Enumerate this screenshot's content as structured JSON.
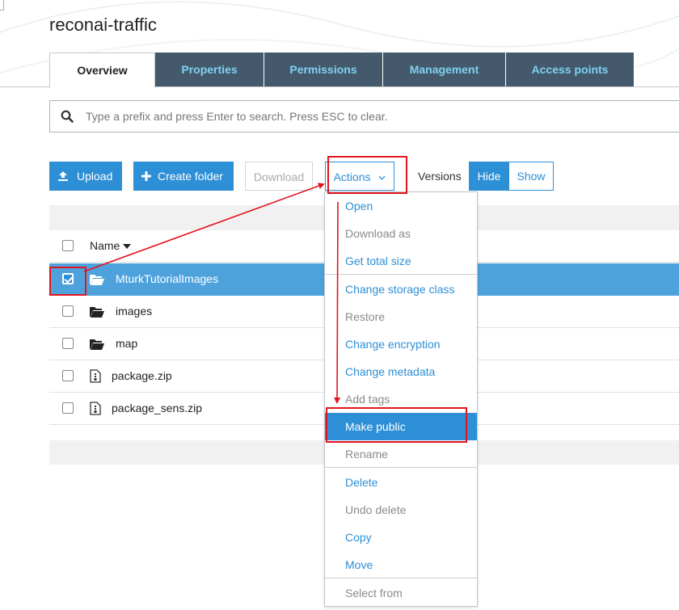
{
  "bucket_title": "reconai-traffic",
  "tabs": [
    {
      "label": "Overview"
    },
    {
      "label": "Properties"
    },
    {
      "label": "Permissions"
    },
    {
      "label": "Management"
    },
    {
      "label": "Access points"
    }
  ],
  "search": {
    "placeholder": "Type a prefix and press Enter to search. Press ESC to clear."
  },
  "toolbar": {
    "upload_label": "Upload",
    "create_folder_label": "Create folder",
    "download_label": "Download",
    "actions_label": "Actions",
    "versions_label": "Versions",
    "hide_label": "Hide",
    "show_label": "Show"
  },
  "table": {
    "name_header": "Name",
    "rows": [
      {
        "name": "MturkTutorialImages",
        "type": "folder",
        "selected": true
      },
      {
        "name": "images",
        "type": "folder",
        "selected": false
      },
      {
        "name": "map",
        "type": "folder",
        "selected": false
      },
      {
        "name": "package.zip",
        "type": "file",
        "selected": false
      },
      {
        "name": "package_sens.zip",
        "type": "file",
        "selected": false
      }
    ]
  },
  "actions_menu": {
    "items": [
      {
        "label": "Open",
        "enabled": true
      },
      {
        "label": "Download as",
        "enabled": false
      },
      {
        "label": "Get total size",
        "enabled": true
      },
      {
        "label": "Change storage class",
        "enabled": true
      },
      {
        "label": "Restore",
        "enabled": false
      },
      {
        "label": "Change encryption",
        "enabled": true
      },
      {
        "label": "Change metadata",
        "enabled": true
      },
      {
        "label": "Add tags",
        "enabled": false
      },
      {
        "label": "Make public",
        "enabled": true,
        "highlighted": true
      },
      {
        "label": "Rename",
        "enabled": false
      },
      {
        "label": "Delete",
        "enabled": true
      },
      {
        "label": "Undo delete",
        "enabled": false
      },
      {
        "label": "Copy",
        "enabled": true
      },
      {
        "label": "Move",
        "enabled": true
      },
      {
        "label": "Select from",
        "enabled": false
      }
    ]
  },
  "colors": {
    "accent": "#2d8fd5",
    "tab_dark": "#445a6c",
    "tab_text": "#7fd0f0",
    "annotation_red": "#e3141e",
    "selected_row": "#4ea2dc"
  }
}
